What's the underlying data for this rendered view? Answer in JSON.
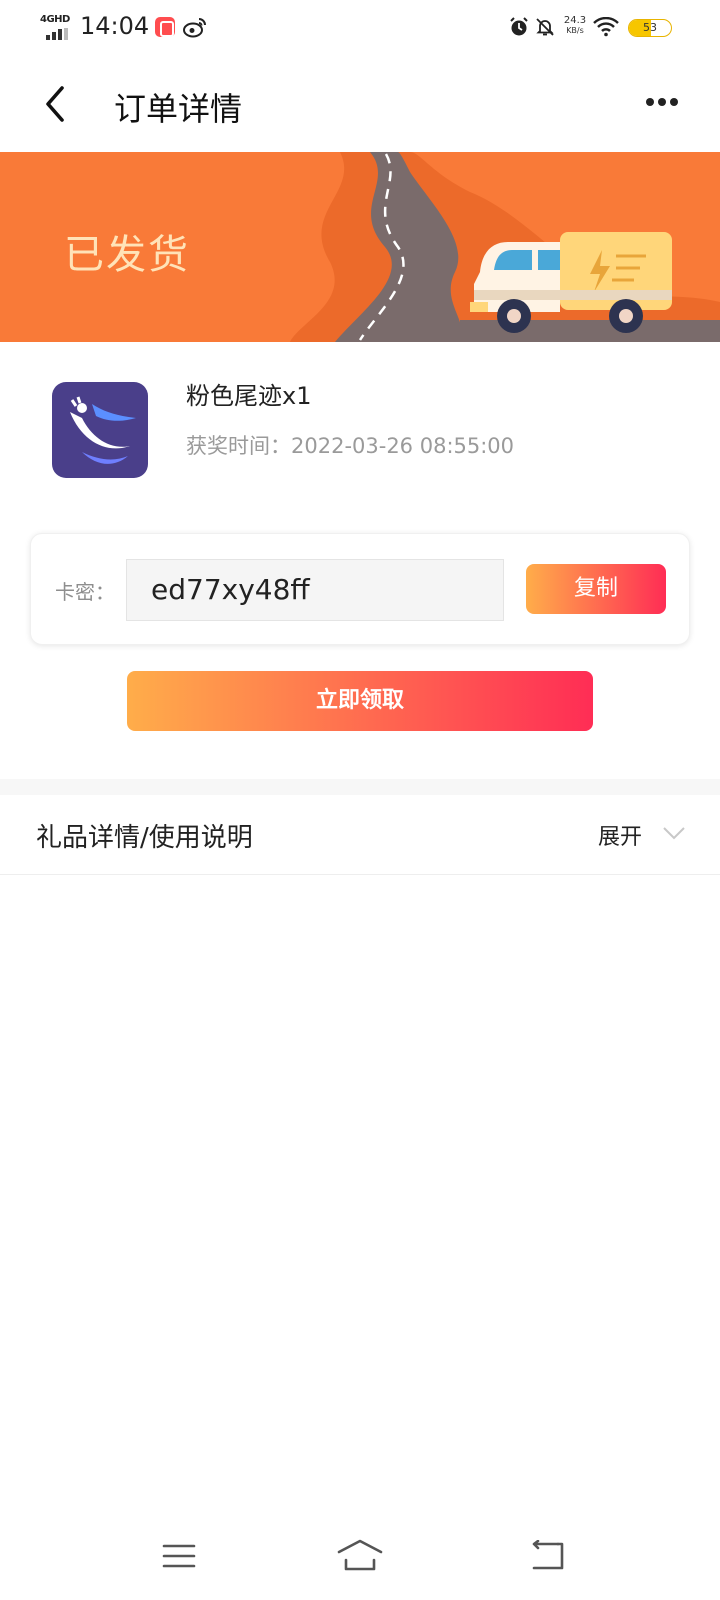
{
  "status_bar": {
    "network": "4GHD",
    "time": "14:04",
    "speed_value": "24.3",
    "speed_unit": "KB/s",
    "battery_level": "53",
    "battery_fraction": 0.53
  },
  "header": {
    "title": "订单详情"
  },
  "banner": {
    "status": "已发货"
  },
  "gift": {
    "name": "粉色尾迹x1",
    "time_label": "获奖时间：",
    "time_value": "2022-03-26 08:55:00"
  },
  "code": {
    "label": "卡密：",
    "value": "ed77xy48ff",
    "copy_label": "复制"
  },
  "claim": {
    "label": "立即领取"
  },
  "details": {
    "title": "礼品详情/使用说明",
    "expand_label": "展开"
  },
  "colors": {
    "banner_orange": "#f97a38",
    "gradient_start": "#ffad4a",
    "gradient_end": "#ff2d55",
    "icon_bg": "#4a3f8a"
  }
}
